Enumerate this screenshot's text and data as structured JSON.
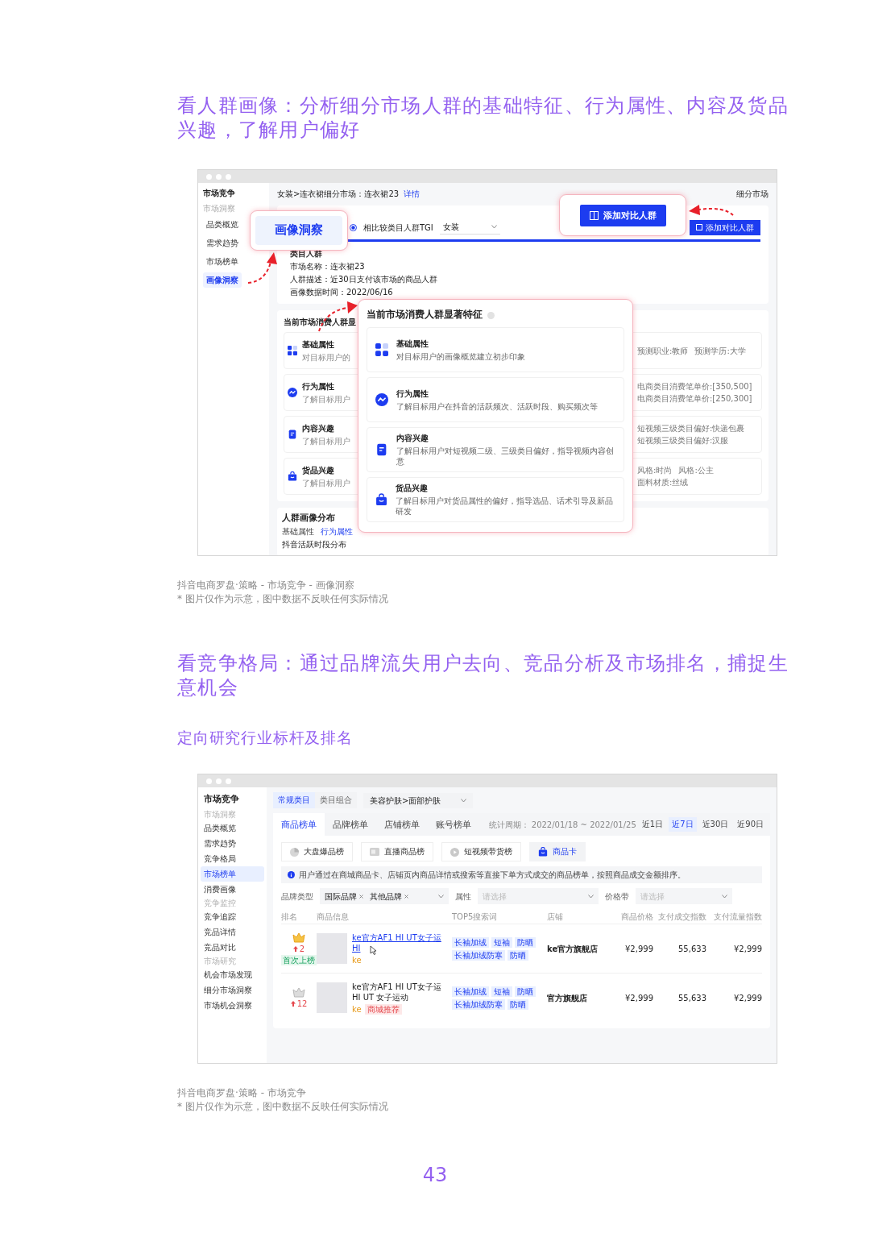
{
  "portrait_section": {
    "heading": "看人群画像：分析细分市场人群的基础特征、行为属性、内容及货品兴趣，了解用户偏好",
    "screenshot": {
      "sidebar": {
        "title": "市场竞争",
        "group": "市场洞察",
        "items": [
          {
            "label": "品类概览",
            "selected": false
          },
          {
            "label": "需求趋势",
            "selected": false
          },
          {
            "label": "市场榜单",
            "selected": false
          },
          {
            "label": "画像洞察",
            "selected": true
          }
        ]
      },
      "breadcrumb": "女装>连衣裙细分市场：连衣裙23",
      "detail_link": "详情",
      "top_right": "细分市场",
      "compare_option": "相比较类目人群TGI",
      "compare_value": "女装",
      "add_button": "添加对比人群",
      "audience": {
        "title": "类目人群",
        "lines": [
          "市场名称：连衣裙23",
          "人群描述：近30日支付该市场的商品人群",
          "画像数据时间：2022/06/16"
        ]
      },
      "features": {
        "title": "当前市场消费人群显",
        "rows": [
          {
            "kind": "basic",
            "label": "基础属性",
            "desc": "对目标用户的",
            "tags": [
              "预测职业:教师",
              "预测学历:大学"
            ]
          },
          {
            "kind": "behavior",
            "label": "行为属性",
            "desc": "了解目标用户",
            "tags": [
              "电商类目消费笔单价:[350,500]",
              "电商类目消费笔单价:[250,300]"
            ]
          },
          {
            "kind": "content",
            "label": "内容兴趣",
            "desc": "了解目标用户",
            "tags": [
              "短视频三级类目偏好:快递包裹",
              "短视频三级类目偏好:汉服"
            ]
          },
          {
            "kind": "goods",
            "label": "货品兴趣",
            "desc": "了解目标用户",
            "tags": [
              "风格:时尚",
              "风格:公主",
              "面料材质:丝绒"
            ]
          }
        ]
      },
      "distribution": {
        "title": "人群画像分布",
        "tabs": [
          {
            "label": "基础属性",
            "selected": false
          },
          {
            "label": "行为属性",
            "selected": true
          }
        ],
        "subtitle": "抖音活跃时段分布"
      },
      "callout_tab": "画像洞察",
      "callout_button": "添加对比人群",
      "popup": {
        "title": "当前市场消费人群显著特征",
        "rows": [
          {
            "kind": "basic",
            "label": "基础属性",
            "desc": "对目标用户的画像概览建立初步印象"
          },
          {
            "kind": "behavior",
            "label": "行为属性",
            "desc": "了解目标用户在抖音的活跃频次、活跃时段、购买频次等"
          },
          {
            "kind": "content",
            "label": "内容兴趣",
            "desc": "了解目标用户对短视频二级、三级类目偏好，指导视频内容创意"
          },
          {
            "kind": "goods",
            "label": "货品兴趣",
            "desc": "了解目标用户对货品属性的偏好，指导选品、话术引导及新品研发"
          }
        ]
      }
    },
    "caption": "抖音电商罗盘·策略 - 市场竞争 - 画像洞察",
    "note": "* 图片仅作为示意，图中数据不反映任何实际情况"
  },
  "competition_section": {
    "heading": "看竞争格局：通过品牌流失用户去向、竞品分析及市场排名，捕捉生意机会",
    "subheading": "定向研究行业标杆及排名",
    "screenshot": {
      "sidebar": {
        "title": "市场竞争",
        "groups": [
          {
            "label": "市场洞察",
            "items": [
              {
                "label": "品类概览",
                "selected": false
              },
              {
                "label": "需求趋势",
                "selected": false
              },
              {
                "label": "竞争格局",
                "selected": false
              },
              {
                "label": "市场榜单",
                "selected": true
              },
              {
                "label": "消费画像",
                "selected": false
              }
            ]
          },
          {
            "label": "竞争监控",
            "items": [
              {
                "label": "竞争追踪",
                "selected": false
              },
              {
                "label": "竞品详情",
                "selected": false
              },
              {
                "label": "竞品对比",
                "selected": false
              }
            ]
          },
          {
            "label": "市场研究",
            "items": [
              {
                "label": "机会市场发现",
                "selected": false
              },
              {
                "label": "细分市场洞察",
                "selected": false
              },
              {
                "label": "市场机会洞察",
                "selected": false
              }
            ]
          }
        ]
      },
      "modes": [
        {
          "label": "常规类目",
          "selected": true
        },
        {
          "label": "类目组合",
          "selected": false
        }
      ],
      "category": "美容护肤>面部护肤",
      "tabs": [
        {
          "label": "商品榜单",
          "selected": true
        },
        {
          "label": "品牌榜单",
          "selected": false
        },
        {
          "label": "店铺榜单",
          "selected": false
        },
        {
          "label": "账号榜单",
          "selected": false
        }
      ],
      "period_label": "统计周期：",
      "period": "2022/01/18 ~ 2022/01/25",
      "ranges": [
        {
          "label": "近1日",
          "selected": false
        },
        {
          "label": "近7日",
          "selected": true
        },
        {
          "label": "近30日",
          "selected": false
        },
        {
          "label": "近90日",
          "selected": false
        }
      ],
      "list_types": [
        {
          "kind": "pie",
          "label": "大盘爆品榜",
          "selected": false
        },
        {
          "kind": "live",
          "label": "直播商品榜",
          "selected": false
        },
        {
          "kind": "video",
          "label": "短视频带货榜",
          "selected": false
        },
        {
          "kind": "bag",
          "label": "商品卡",
          "selected": true
        }
      ],
      "info": "用户通过在商城商品卡、店铺页内商品详情或搜索等直接下单方式成交的商品榜单，按照商品成交金额排序。",
      "filters": {
        "brand_label": "品牌类型",
        "brand_chips": [
          "国际品牌",
          "其他品牌"
        ],
        "attr_label": "属性",
        "attr_placeholder": "请选择",
        "price_label": "价格带",
        "price_placeholder": "请选择"
      },
      "columns": [
        "排名",
        "商品信息",
        "TOP5搜索词",
        "店铺",
        "商品价格",
        "支付成交指数",
        "支付流量指数"
      ],
      "rows": [
        {
          "kind": "gold",
          "rank_change": "2",
          "badge": "首次上榜",
          "title": "ke官方AF1 HI UT女子运 HI",
          "brand_tag": "ke",
          "hovered": true,
          "search_words": [
            "长袖加绒",
            "短袖",
            "防晒",
            "长袖加绒防寒",
            "防晒"
          ],
          "store": "ke官方旗舰店",
          "price": "¥2,999",
          "deal_index": "55,633",
          "flow_index": "¥2,999"
        },
        {
          "kind": "silver",
          "rank_change": "12",
          "title": "ke官方AF1 HI UT女子运 HI UT 女子运动",
          "brand_tag": "ke",
          "promo": "商城推荐",
          "hovered": false,
          "search_words": [
            "长袖加绒",
            "短袖",
            "防晒",
            "长袖加绒防寒",
            "防晒"
          ],
          "store": "官方旗舰店",
          "price": "¥2,999",
          "deal_index": "55,633",
          "flow_index": "¥2,999"
        }
      ]
    },
    "caption": "抖音电商罗盘·策略 - 市场竞争",
    "note": "* 图片仅作为示意，图中数据不反映任何实际情况"
  },
  "page_number": "43"
}
